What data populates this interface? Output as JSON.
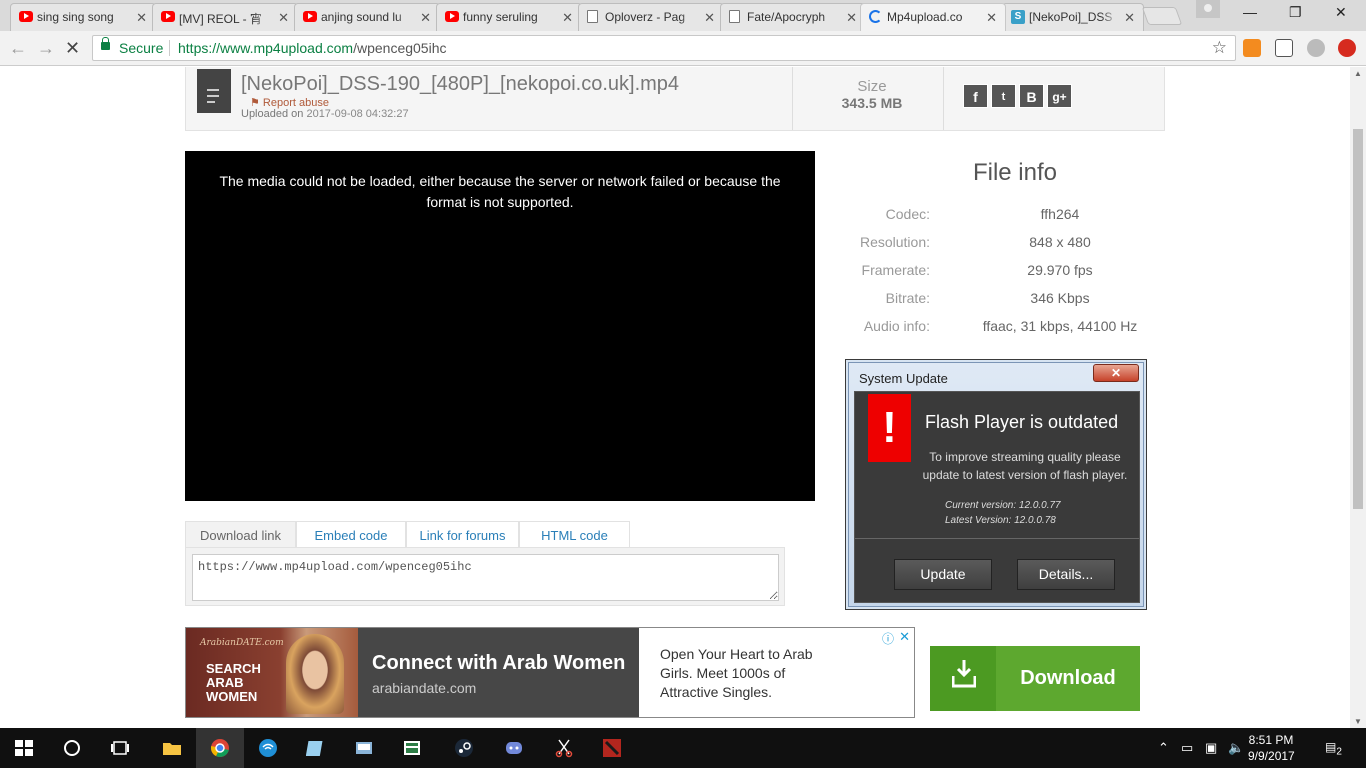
{
  "browser": {
    "tabs": [
      {
        "label": "sing sing song",
        "favicon": "youtube-icon"
      },
      {
        "label": "[MV] REOL - 宵",
        "favicon": "youtube-icon"
      },
      {
        "label": "anjing sound lu",
        "favicon": "youtube-icon"
      },
      {
        "label": "funny seruling",
        "favicon": "youtube-icon"
      },
      {
        "label": "Oploverz - Pag",
        "favicon": "document-icon"
      },
      {
        "label": "Fate/Apocryph",
        "favicon": "document-icon"
      },
      {
        "label": "Mp4upload.co",
        "favicon": "loading-icon"
      },
      {
        "label": "[NekoPoi]_DSS",
        "favicon": "s-icon"
      }
    ],
    "secure_label": "Secure",
    "url_scheme_host": "https://www.mp4upload.com",
    "url_path": "/wpenceg05ihc"
  },
  "file": {
    "name": "[NekoPoi]_DSS-190_[480P]_[nekopoi.co.uk].mp4",
    "report": "⚑ Report abuse",
    "uploaded_prefix": "Uploaded on",
    "uploaded_date": "2017-09-08 04:32:27",
    "size_label": "Size",
    "size_value": "343.5 MB",
    "share": [
      "f",
      "t",
      "B",
      "g+"
    ]
  },
  "player": {
    "message": "The media could not be loaded, either because the server or network failed or because the format is not supported."
  },
  "file_info": {
    "title": "File info",
    "rows": [
      {
        "key": "Codec:",
        "value": "ffh264"
      },
      {
        "key": "Resolution:",
        "value": "848 x 480"
      },
      {
        "key": "Framerate:",
        "value": "29.970 fps"
      },
      {
        "key": "Bitrate:",
        "value": "346 Kbps"
      },
      {
        "key": "Audio info:",
        "value": "ffaac, 31 kbps, 44100 Hz"
      }
    ]
  },
  "dialog": {
    "title": "System Update",
    "close": "✕",
    "warning": "!",
    "heading": "Flash Player is outdated",
    "text": "To improve streaming quality please update to latest version of flash player.",
    "current": "Current version: 12.0.0.77",
    "latest": "Latest Version: 12.0.0.78",
    "update": "Update",
    "details": "Details..."
  },
  "link_tabs": [
    "Download link",
    "Embed code",
    "Link for forums",
    "HTML code"
  ],
  "link_value": "https://www.mp4upload.com/wpenceg05ihc",
  "ad": {
    "logo": "ArabianDATE.com",
    "image_text_1": "SEARCH",
    "image_text_2": "ARAB",
    "image_text_3": "WOMEN",
    "headline": "Connect with Arab Women",
    "domain": "arabiandate.com",
    "copy": "Open Your Heart to Arab Girls. Meet 1000s of Attractive Singles.",
    "info": "ⓘ",
    "close": "✕"
  },
  "download_label": "Download",
  "taskbar": {
    "time": "8:51 PM",
    "date": "9/9/2017",
    "notifications": "2"
  },
  "colors": {
    "secure_green": "#0b8043",
    "download_green": "#5da82f",
    "warning_red": "#e00000",
    "link_blue": "#2a7fb8"
  }
}
